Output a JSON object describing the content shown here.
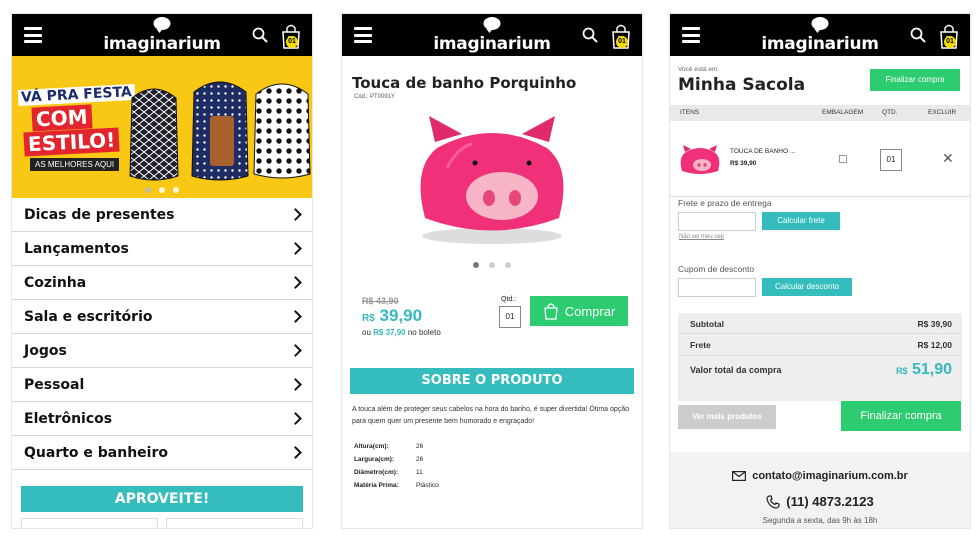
{
  "brand": {
    "logo_text": "imaginarium",
    "badge_count": "01",
    "accent": "#35bdbd",
    "green": "#2ecc71",
    "banner_bg": "#f9c814"
  },
  "screen1": {
    "banner": {
      "line1": "VÁ PRA FESTA",
      "line2": "COM",
      "line3": "ESTILO!",
      "line4": "AS MELHORES AQUI"
    },
    "menu": [
      {
        "label": "Dicas de presentes"
      },
      {
        "label": "Lançamentos"
      },
      {
        "label": "Cozinha"
      },
      {
        "label": "Sala e escritório"
      },
      {
        "label": "Jogos"
      },
      {
        "label": "Pessoal"
      },
      {
        "label": "Eletrônicos"
      },
      {
        "label": "Quarto e banheiro"
      }
    ],
    "promo_label": "APROVEITE!"
  },
  "screen2": {
    "title": "Touca de banho Porquinho",
    "code": "Cód.: PT0091Y",
    "old_price": "R$ 43,90",
    "currency": "R$",
    "new_price": "39,90",
    "boleto_prefix": "ou",
    "boleto_price": "R$ 37,90",
    "boleto_suffix": "no boleto",
    "qty_label": "Qtd.:",
    "qty_value": "01",
    "buy_label": "Comprar",
    "about_label": "SOBRE O PRODUTO",
    "description": "A touca além de proteger seus cabelos na hora do banho, é super divertida! Ótima opção para quem quer um presente bem humorado e engraçado!",
    "specs": [
      {
        "name": "Altura(cm):",
        "value": "26"
      },
      {
        "name": "Largura(cm):",
        "value": "26"
      },
      {
        "name": "Diâmetro(cm):",
        "value": "11"
      },
      {
        "name": "Matéria Prima:",
        "value": "Plástico"
      }
    ]
  },
  "screen3": {
    "breadcrumb": "Você está em",
    "title": "Minha Sacola",
    "checkout_top": "Finalizar compra",
    "headers": {
      "itens": "ITENS",
      "embalagem": "EMBALAGEM",
      "qtd": "QTD.",
      "excluir": "EXCLUIR"
    },
    "item": {
      "name": "TOUCA DE BANHO ...",
      "price": "R$ 39,90",
      "qty": "01",
      "remove": "✕"
    },
    "shipping_label": "Frete e prazo de entrega",
    "shipping_button": "Calcular frete",
    "cep_link": "Não sei meu cep",
    "coupon_label": "Cupom de desconto",
    "coupon_button": "Calcular desconto",
    "subtotal_label": "Subtotal",
    "subtotal_value": "R$ 39,90",
    "frete_label": "Frete",
    "frete_value": "R$ 12,00",
    "total_label": "Valor total da compra",
    "total_currency": "R$",
    "total_value": "51,90",
    "more_products": "Ver mais produtos",
    "checkout_bottom": "Finalizar compra",
    "email": "contato@imaginarium.com.br",
    "phone": "(11) 4873.2123",
    "hours": "Segunda a sexta, das 9h às 18h"
  }
}
